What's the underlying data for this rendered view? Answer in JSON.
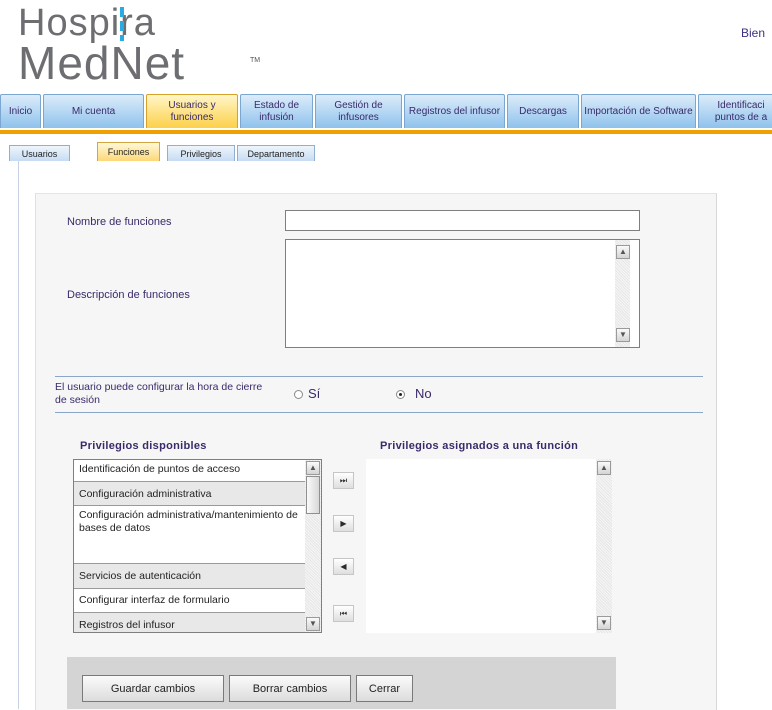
{
  "brand": {
    "logo_line1": "Hospira",
    "logo_line2": "MedNet",
    "tm": "TM",
    "accent": "#29abe2"
  },
  "header": {
    "welcome": "Bien"
  },
  "main_tabs": [
    {
      "label": "Inicio"
    },
    {
      "label": "Mi cuenta"
    },
    {
      "label": "Usuarios y funciones"
    },
    {
      "label": "Estado de infusión"
    },
    {
      "label": "Gestión de infusores"
    },
    {
      "label": "Registros del infusor"
    },
    {
      "label": "Descargas"
    },
    {
      "label": "Importación de Software"
    },
    {
      "label": "Identificaci puntos de a"
    }
  ],
  "sub_tabs": [
    {
      "label": "Usuarios"
    },
    {
      "label": "Funciones"
    },
    {
      "label": "Privilegios"
    },
    {
      "label": "Departamento"
    }
  ],
  "form": {
    "name_label": "Nombre de funciones",
    "name_value": "",
    "desc_label": "Descripción de funciones",
    "desc_value": "",
    "logout_label": "El usuario puede configurar la hora de cierre de sesión",
    "radio_yes": "Sí",
    "radio_no": "No",
    "selected": "No"
  },
  "privileges": {
    "available_title": "Privilegios disponibles",
    "assigned_title": "Privilegios asignados a una función",
    "available": [
      "Identificación de puntos de acceso",
      "Configuración administrativa",
      "Configuración administrativa/mantenimiento de bases de datos",
      "Servicios de autenticación",
      "Configurar interfaz de formulario",
      "Registros del infusor"
    ],
    "assigned": [],
    "move_buttons": [
      "⏭",
      "▶",
      "◀",
      "⏮"
    ]
  },
  "buttons": {
    "save": "Guardar cambios",
    "clear": "Borrar cambios",
    "close": "Cerrar"
  }
}
